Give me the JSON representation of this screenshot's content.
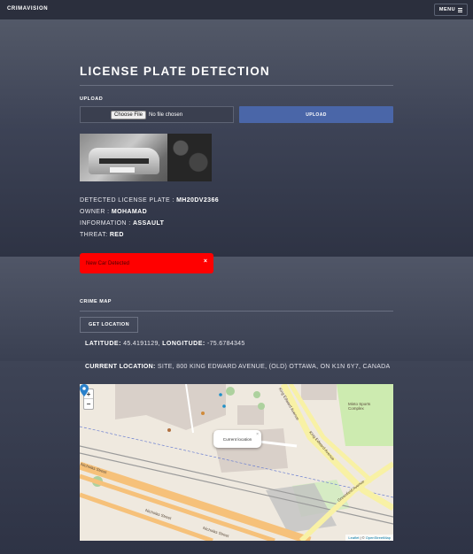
{
  "nav": {
    "brand": "CRIMAVISION",
    "menu_label": "MENU"
  },
  "page": {
    "title": "LICENSE PLATE DETECTION"
  },
  "upload": {
    "section_label": "UPLOAD",
    "choose_file_label": "Choose File",
    "no_file_text": "No file chosen",
    "upload_button_label": "UPLOAD"
  },
  "detection": {
    "plate_label": "DETECTED LICENSE PLATE :",
    "plate_value": "MH20DV2366",
    "owner_label": "OWNER :",
    "owner_value": "MOHAMAD",
    "information_label": "INFORMATION :",
    "information_value": "ASSAULT",
    "threat_label": "THREAT:",
    "threat_value": "RED"
  },
  "alert": {
    "message": "New Car Detected",
    "close_glyph": "×"
  },
  "crime_map": {
    "section_label": "CRIME MAP",
    "get_location_label": "GET LOCATION",
    "latitude_label": "LATITUDE:",
    "latitude_value": "45.4191129,",
    "longitude_label": "LONGITUDE:",
    "longitude_value": "-75.6784345",
    "current_location_label": "CURRENT LOCATION:",
    "current_location_value": "SITE, 800 KING EDWARD AVENUE, (OLD) OTTAWA, ON K1N 6Y7, CANADA"
  },
  "map": {
    "zoom_in": "+",
    "zoom_out": "−",
    "popup_text": "Current location",
    "popup_close": "×",
    "attribution_leaflet": "Leaflet",
    "attribution_sep": " | © ",
    "attribution_osm": "OpenStreetMap",
    "street_labels": [
      "Nicholas Street",
      "Nicholas Street",
      "Nicholas Street",
      "King Edward Avenue",
      "King Edward Avenue",
      "Greenfield Avenue"
    ],
    "poi_label": "Minto Sports Complex"
  },
  "icons": {
    "menu": "hamburger-icon",
    "marker": "map-marker-icon",
    "close": "close-icon"
  },
  "colors": {
    "alert": "#ff0000",
    "upload_button": "#4a66a8",
    "marker": "#2a81cb"
  }
}
